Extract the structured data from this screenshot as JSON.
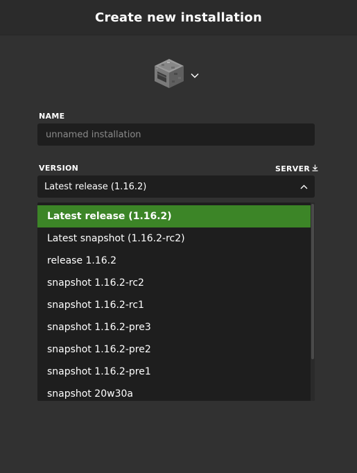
{
  "header": {
    "title": "Create new installation"
  },
  "icon_picker": {
    "icon": "furnace-icon",
    "chevron": "chevron-down-icon"
  },
  "name_field": {
    "label": "NAME",
    "value": "",
    "placeholder": "unnamed installation"
  },
  "version": {
    "label": "VERSION",
    "server_link": "SERVER",
    "server_icon": "download-icon",
    "selected": "Latest release (1.16.2)",
    "open": true,
    "options": [
      {
        "label": "Latest release (1.16.2)",
        "selected": true
      },
      {
        "label": "Latest snapshot (1.16.2-rc2)",
        "selected": false
      },
      {
        "label": "release 1.16.2",
        "selected": false
      },
      {
        "label": "snapshot 1.16.2-rc2",
        "selected": false
      },
      {
        "label": "snapshot 1.16.2-rc1",
        "selected": false
      },
      {
        "label": "snapshot 1.16.2-pre3",
        "selected": false
      },
      {
        "label": "snapshot 1.16.2-pre2",
        "selected": false
      },
      {
        "label": "snapshot 1.16.2-pre1",
        "selected": false
      },
      {
        "label": "snapshot 20w30a",
        "selected": false
      }
    ]
  },
  "colors": {
    "background": "#313131",
    "header_bg": "#2b2b2b",
    "field_bg": "#1e1e1e",
    "selected_green": "#3c8527",
    "text": "#ffffff",
    "placeholder": "#8a8a8a"
  }
}
